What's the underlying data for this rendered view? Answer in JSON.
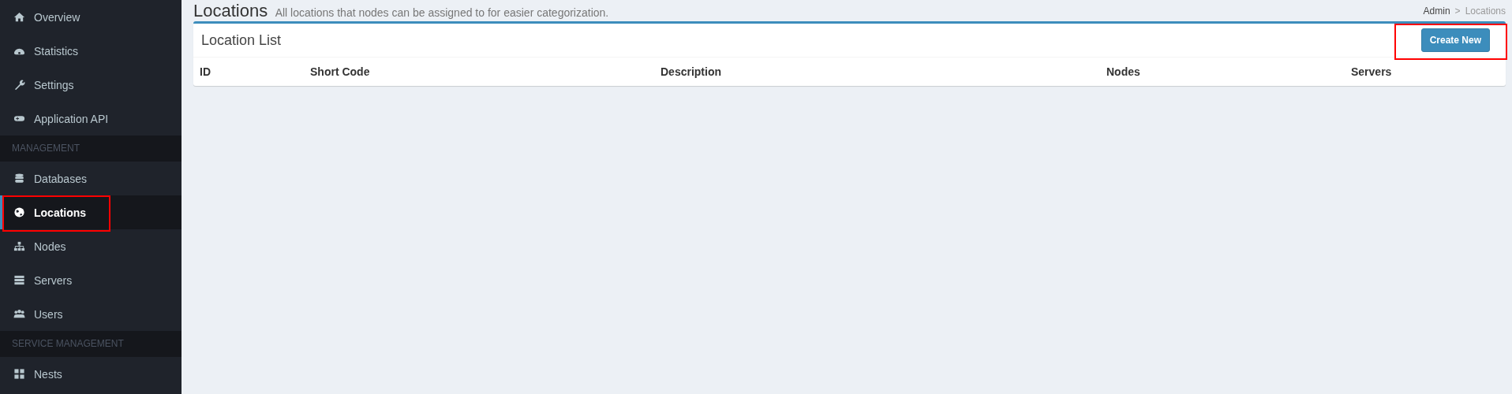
{
  "sidebar": {
    "groups": [
      {
        "items": [
          {
            "label": "Overview",
            "selected": false,
            "highlighted": false
          },
          {
            "label": "Statistics",
            "selected": false,
            "highlighted": false
          },
          {
            "label": "Settings",
            "selected": false,
            "highlighted": false
          },
          {
            "label": "Application API",
            "selected": false,
            "highlighted": false
          }
        ]
      },
      {
        "heading": "MANAGEMENT",
        "items": [
          {
            "label": "Databases",
            "selected": false,
            "highlighted": false
          },
          {
            "label": "Locations",
            "selected": true,
            "highlighted": true
          },
          {
            "label": "Nodes",
            "selected": false,
            "highlighted": false
          },
          {
            "label": "Servers",
            "selected": false,
            "highlighted": false
          },
          {
            "label": "Users",
            "selected": false,
            "highlighted": false
          }
        ]
      },
      {
        "heading": "SERVICE MANAGEMENT",
        "items": [
          {
            "label": "Nests",
            "selected": false,
            "highlighted": false
          }
        ]
      }
    ]
  },
  "page": {
    "title": "Locations",
    "subtitle": "All locations that nodes can be assigned to for easier categorization.",
    "breadcrumb": [
      "Admin",
      "Locations"
    ],
    "breadcrumb_separator": ">"
  },
  "card": {
    "title": "Location List",
    "button": {
      "label": "Create New",
      "highlighted": true
    },
    "columns": [
      "ID",
      "Short Code",
      "Description",
      "Nodes",
      "Servers"
    ]
  }
}
